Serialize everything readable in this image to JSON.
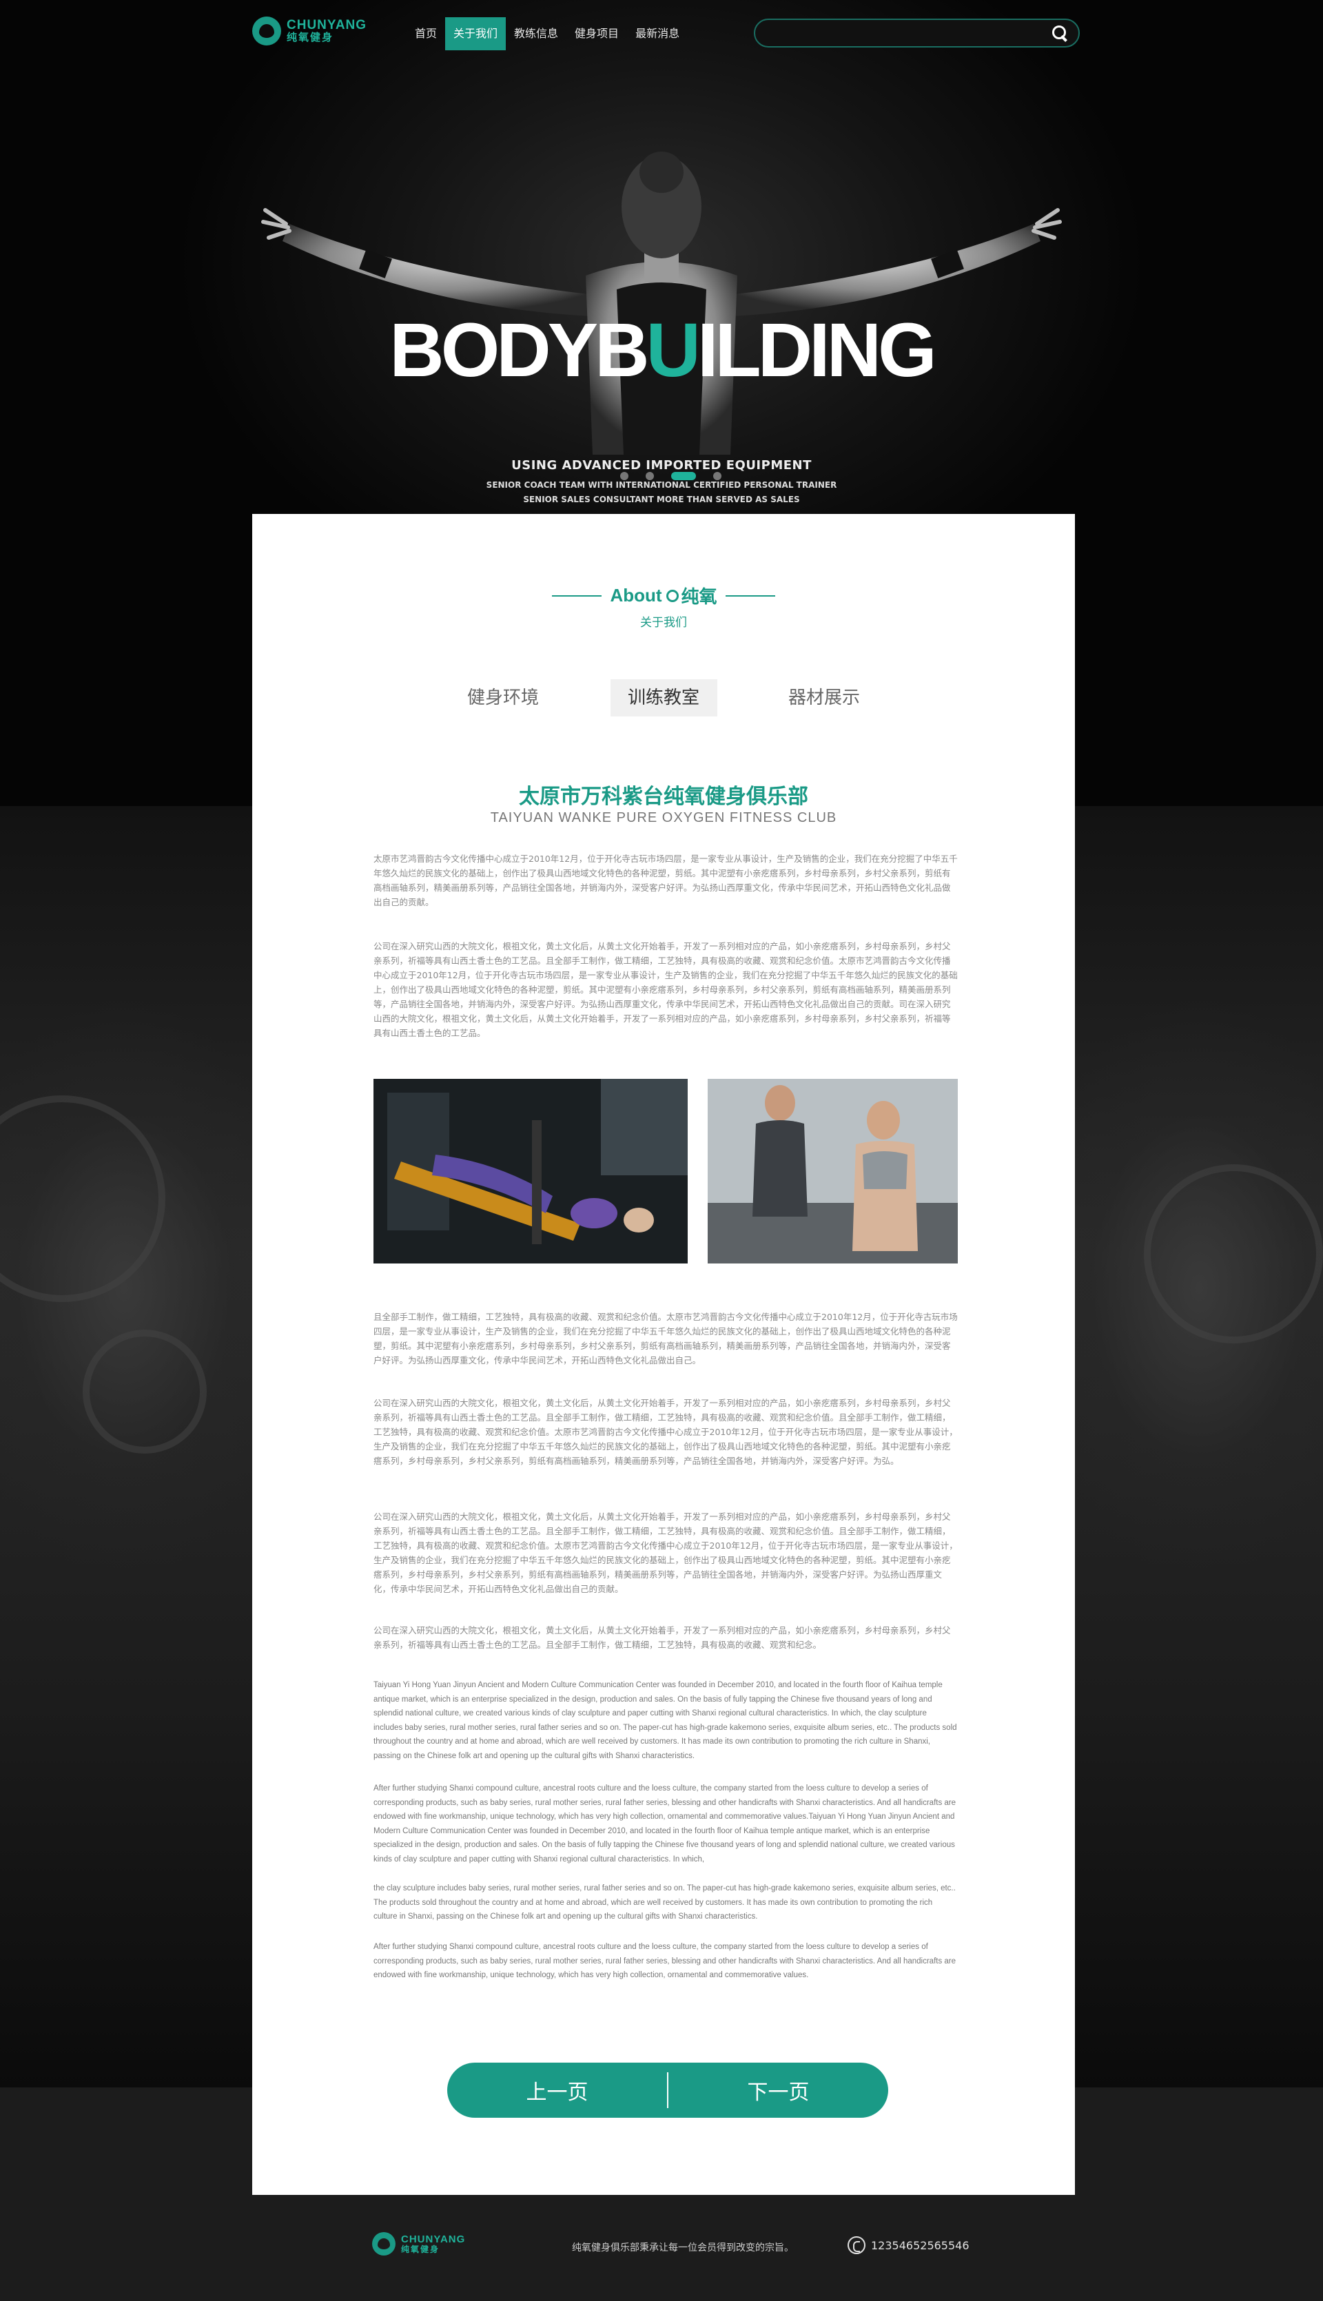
{
  "brand": {
    "logo_en": "CHUNYANG",
    "logo_cn": "纯氧健身",
    "accent": "#1a9a86"
  },
  "nav": {
    "items": [
      {
        "label": "首页",
        "active": false
      },
      {
        "label": "关于我们",
        "active": true
      },
      {
        "label": "教练信息",
        "active": false
      },
      {
        "label": "健身项目",
        "active": false
      },
      {
        "label": "最新消息",
        "active": false
      }
    ]
  },
  "search": {
    "placeholder": "",
    "icon": "search-icon"
  },
  "hero": {
    "title_a": "BODYB",
    "title_u": "U",
    "title_b": "ILDING",
    "subtitle": "USING ADVANCED IMPORTED EQUIPMENT",
    "line1": "SENIOR COACH TEAM WITH INTERNATIONAL CERTIFIED PERSONAL TRAINER",
    "line2": "SENIOR SALES CONSULTANT MORE THAN SERVED AS SALES",
    "slide_count": 4,
    "active_slide": 3
  },
  "about": {
    "title_en": "About",
    "title_cn": "纯氧",
    "subtitle": "关于我们"
  },
  "tabs": [
    {
      "label": "健身环境",
      "active": false
    },
    {
      "label": "训练教室",
      "active": true
    },
    {
      "label": "器材展示",
      "active": false
    }
  ],
  "club": {
    "title": "太原市万科紫台纯氧健身俱乐部",
    "title_en": "TAIYUAN WANKE PURE OXYGEN FITNESS CLUB"
  },
  "paragraphs_top": [
    "太原市艺鸿晋韵古今文化传播中心成立于2010年12月，位于开化寺古玩市场四层，是一家专业从事设计，生产及销售的企业，我们在充分挖掘了中华五千年悠久灿烂的民族文化的基础上，创作出了极具山西地域文化特色的各种泥塑，剪纸。其中泥塑有小亲疙瘩系列，乡村母亲系列，乡村父亲系列，剪纸有高档画轴系列，精美画册系列等，产品销往全国各地，并销海内外，深受客户好评。为弘扬山西厚重文化，传承中华民间艺术，开拓山西特色文化礼品做出自己的贡献。",
    "公司在深入研究山西的大院文化，根祖文化，黄土文化后，从黄土文化开始着手，开发了一系列相对应的产品，如小亲疙瘩系列，乡村母亲系列，乡村父亲系列，祈福等具有山西土香土色的工艺品。且全部手工制作，做工精细，工艺独特，具有极高的收藏、观赏和纪念价值。太原市艺鸿晋韵古今文化传播中心成立于2010年12月，位于开化寺古玩市场四层，是一家专业从事设计，生产及销售的企业，我们在充分挖掘了中华五千年悠久灿烂的民族文化的基础上，创作出了极具山西地域文化特色的各种泥塑，剪纸。其中泥塑有小亲疙瘩系列，乡村母亲系列，乡村父亲系列，剪纸有高档画轴系列，精美画册系列等，产品销往全国各地，并销海内外，深受客户好评。为弘扬山西厚重文化，传承中华民间艺术，开拓山西特色文化礼品做出自己的贡献。司在深入研究山西的大院文化，根祖文化，黄土文化后，从黄土文化开始着手，开发了一系列相对应的产品，如小亲疙瘩系列，乡村母亲系列，乡村父亲系列，祈福等具有山西土香土色的工艺品。"
  ],
  "paragraphs_mid": [
    "且全部手工制作，做工精细，工艺独特，具有极高的收藏、观赏和纪念价值。太原市艺鸿晋韵古今文化传播中心成立于2010年12月，位于开化寺古玩市场四层，是一家专业从事设计，生产及销售的企业，我们在充分挖掘了中华五千年悠久灿烂的民族文化的基础上，创作出了极具山西地域文化特色的各种泥塑，剪纸。其中泥塑有小亲疙瘩系列，乡村母亲系列，乡村父亲系列，剪纸有高档画轴系列，精美画册系列等，产品销往全国各地，并销海内外，深受客户好评。为弘扬山西厚重文化，传承中华民间艺术，开拓山西特色文化礼品做出自己。",
    "公司在深入研究山西的大院文化，根祖文化，黄土文化后，从黄土文化开始着手，开发了一系列相对应的产品，如小亲疙瘩系列，乡村母亲系列，乡村父亲系列，祈福等具有山西土香土色的工艺品。且全部手工制作，做工精细，工艺独特，具有极高的收藏、观赏和纪念价值。且全部手工制作，做工精细，工艺独特，具有极高的收藏、观赏和纪念价值。太原市艺鸿晋韵古今文化传播中心成立于2010年12月，位于开化寺古玩市场四层，是一家专业从事设计，生产及销售的企业，我们在充分挖掘了中华五千年悠久灿烂的民族文化的基础上，创作出了极具山西地域文化特色的各种泥塑，剪纸。其中泥塑有小亲疙瘩系列，乡村母亲系列，乡村父亲系列，剪纸有高档画轴系列，精美画册系列等，产品销往全国各地，并销海内外，深受客户好评。为弘。",
    "公司在深入研究山西的大院文化，根祖文化，黄土文化后，从黄土文化开始着手，开发了一系列相对应的产品，如小亲疙瘩系列，乡村母亲系列，乡村父亲系列，祈福等具有山西土香土色的工艺品。且全部手工制作，做工精细，工艺独特，具有极高的收藏、观赏和纪念价值。且全部手工制作，做工精细，工艺独特，具有极高的收藏、观赏和纪念价值。太原市艺鸿晋韵古今文化传播中心成立于2010年12月，位于开化寺古玩市场四层，是一家专业从事设计，生产及销售的企业，我们在充分挖掘了中华五千年悠久灿烂的民族文化的基础上，创作出了极具山西地域文化特色的各种泥塑，剪纸。其中泥塑有小亲疙瘩系列，乡村母亲系列，乡村父亲系列，剪纸有高档画轴系列，精美画册系列等，产品销往全国各地，并销海内外，深受客户好评。为弘扬山西厚重文化，传承中华民间艺术，开拓山西特色文化礼品做出自己的贡献。",
    "公司在深入研究山西的大院文化，根祖文化，黄土文化后，从黄土文化开始着手，开发了一系列相对应的产品，如小亲疙瘩系列，乡村母亲系列，乡村父亲系列，祈福等具有山西土香土色的工艺品。且全部手工制作，做工精细，工艺独特，具有极高的收藏、观赏和纪念。"
  ],
  "paragraphs_en": [
    "Taiyuan Yi Hong Yuan Jinyun Ancient and Modern Culture Communication Center was founded in December 2010, and located in the fourth floor of Kaihua temple antique market, which is an enterprise specialized in the design, production and sales. On the basis of fully tapping the Chinese five thousand years of long and splendid national culture, we created various kinds of clay sculpture and paper cutting with Shanxi regional cultural characteristics. In which, the clay sculpture includes baby series, rural mother series, rural father series and so on. The paper-cut has high-grade kakemono series, exquisite album series, etc.. The products sold throughout the country and at home and abroad, which are well received by customers. It has made its own contribution to promoting the rich culture in Shanxi, passing on the Chinese folk art and opening up the cultural gifts with Shanxi characteristics.",
    "After further studying Shanxi compound culture, ancestral roots culture and the loess culture, the company started from the loess culture to develop a series of corresponding products, such as baby series, rural mother series, rural father series, blessing and other handicrafts with Shanxi characteristics. And all handicrafts are endowed with fine workmanship, unique technology, which has very high collection, ornamental and commemorative values.Taiyuan Yi Hong Yuan Jinyun Ancient and Modern Culture Communication Center was founded in December 2010, and located in the fourth floor of Kaihua temple antique market, which is an enterprise specialized in the design, production and sales. On the basis of fully tapping the Chinese five thousand years of long and splendid national culture, we created various kinds of clay sculpture and paper cutting with Shanxi regional cultural characteristics. In which,",
    " the clay sculpture includes baby series, rural mother series, rural father series and so on. The paper-cut has high-grade kakemono series, exquisite album series, etc.. The products sold throughout the country and at home and abroad, which are well received by customers. It has made its own contribution to promoting the rich culture in Shanxi, passing on the Chinese folk art and opening up the cultural gifts with Shanxi characteristics.",
    "After further studying Shanxi compound culture, ancestral roots culture and the loess culture, the company started from the loess culture to develop a series of corresponding products, such as baby series, rural mother series, rural father series, blessing and other handicrafts with Shanxi characteristics. And all handicrafts are endowed with fine workmanship, unique technology, which has very high collection, ornamental and commemorative values."
  ],
  "photos": [
    {
      "name": "gym-bench-photo"
    },
    {
      "name": "treadmill-couple-photo"
    }
  ],
  "pager": {
    "prev": "上一页",
    "next": "下一页"
  },
  "footer": {
    "logo_en": "CHUNYANG",
    "logo_cn": "纯氧健身",
    "slogan": "纯氧健身俱乐部秉承让每一位会员得到改变的宗旨。",
    "phone": "12354652565546"
  }
}
